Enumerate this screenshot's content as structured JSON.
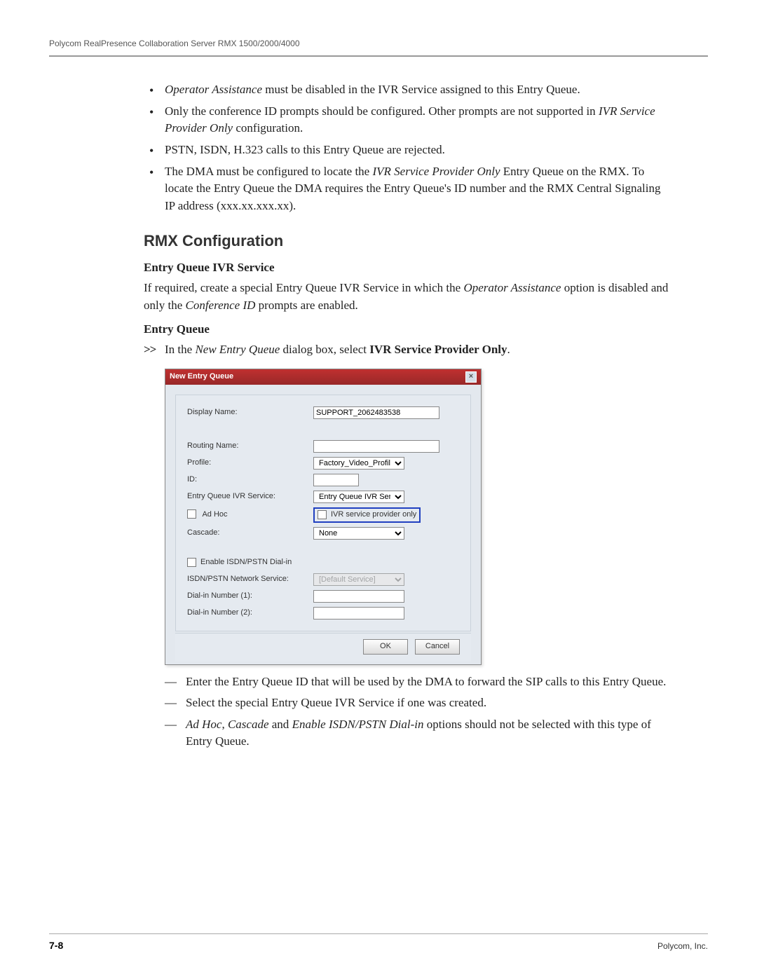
{
  "header": "Polycom RealPresence Collaboration Server RMX 1500/2000/4000",
  "bullets": [
    {
      "pre_italic": "Operator Assistance",
      "rest": " must be disabled in the IVR Service assigned to this Entry Queue."
    },
    {
      "plain1": "Only the conference ID prompts should be configured. Other prompts are not supported in ",
      "mid_italic": "IVR Service Provider Only",
      "plain2": " configuration."
    },
    {
      "plain1": "PSTN, ISDN, H.323 calls to this Entry Queue are rejected."
    },
    {
      "plain1": "The DMA must be configured to locate the ",
      "mid_italic": "IVR Service Provider Only",
      "plain2": " Entry Queue on the RMX. To locate the Entry Queue the DMA requires the Entry Queue's ID number and the RMX Central Signaling IP address (xxx.xx.xxx.xx)."
    }
  ],
  "section_heading": "RMX Configuration",
  "subheading1": "Entry Queue IVR Service",
  "para1_a": "If required, create a special Entry Queue IVR Service in which the ",
  "para1_italic1": "Operator Assistance",
  "para1_b": " option is disabled and only the ",
  "para1_italic2": "Conference ID",
  "para1_c": " prompts are enabled.",
  "subheading2": "Entry Queue",
  "step_a": "In the ",
  "step_italic": "New Entry Queue",
  "step_b": " dialog box, select ",
  "step_bold": "IVR Service Provider Only",
  "step_c": ".",
  "dialog": {
    "title": "New Entry Queue",
    "display_name_label": "Display Name:",
    "display_name_value": "SUPPORT_2062483538",
    "routing_name_label": "Routing Name:",
    "profile_label": "Profile:",
    "profile_value": "Factory_Video_Profile",
    "id_label": "ID:",
    "eq_ivr_label": "Entry Queue IVR Service:",
    "eq_ivr_value": "Entry Queue IVR Service",
    "adhoc_label": "Ad Hoc",
    "ivr_provider_label": "IVR service provider only",
    "cascade_label": "Cascade:",
    "cascade_value": "None",
    "enable_isdn_label": "Enable ISDN/PSTN Dial-in",
    "isdn_service_label": "ISDN/PSTN Network Service:",
    "isdn_service_value": "[Default Service]",
    "dialin1_label": "Dial-in Number (1):",
    "dialin2_label": "Dial-in Number (2):",
    "ok": "OK",
    "cancel": "Cancel"
  },
  "dash_items": {
    "d1": "Enter the Entry Queue ID that will be used by the DMA to forward the SIP calls to this Entry Queue.",
    "d2": "Select the special Entry Queue IVR Service if one was created.",
    "d3_i1": "Ad Hoc",
    "d3_p1": ", ",
    "d3_i2": "Cascade",
    "d3_p2": " and ",
    "d3_i3": "Enable ISDN/PSTN Dial-in",
    "d3_p3": " options should not be selected with this type of Entry Queue."
  },
  "footer": {
    "page_num": "7-8",
    "company": "Polycom, Inc."
  }
}
